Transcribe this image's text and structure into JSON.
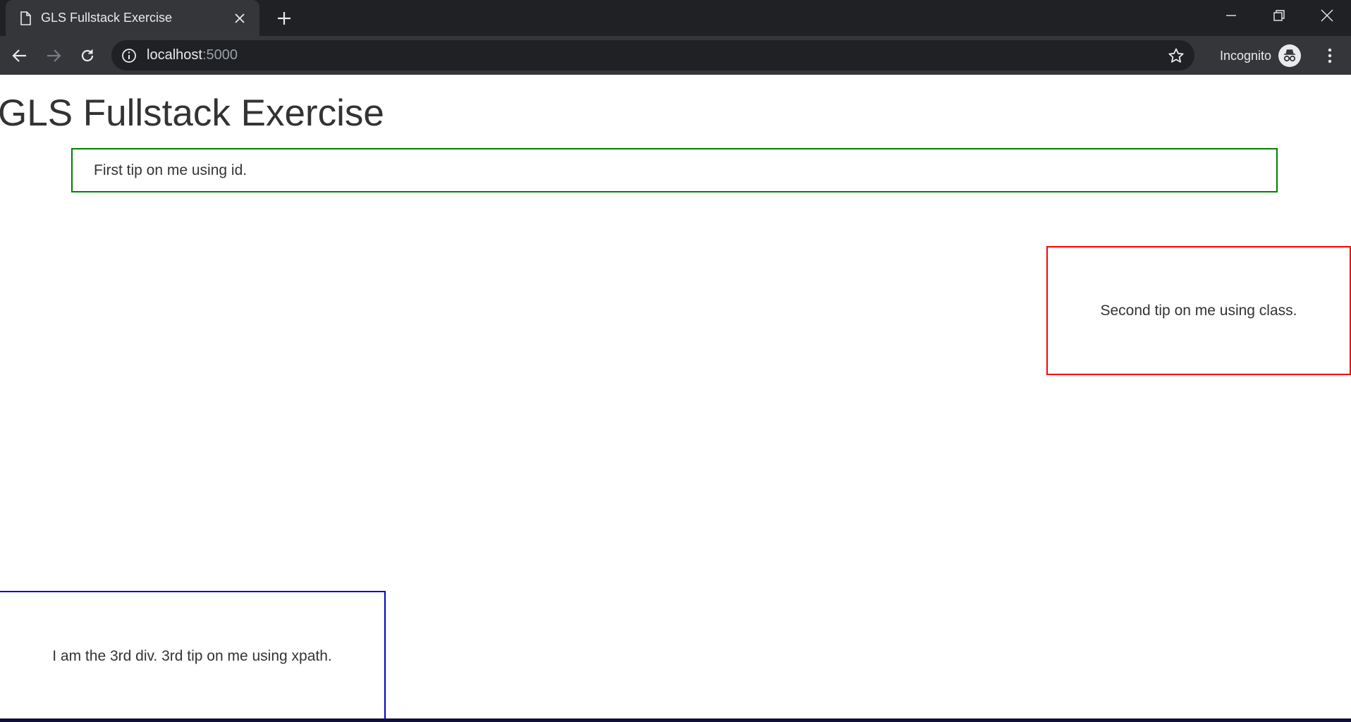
{
  "browser": {
    "tab_title": "GLS Fullstack Exercise",
    "url_host": "localhost",
    "url_port": ":5000",
    "incognito_label": "Incognito",
    "colors": {
      "tabstrip": "#202124",
      "toolbar": "#35363a",
      "omnibox": "#202124",
      "text": "#e8eaed"
    }
  },
  "page": {
    "title": "GLS Fullstack Exercise",
    "tips": [
      {
        "text": "First tip on me using id.",
        "border_color": "#008000"
      },
      {
        "text": "Second tip on me using class.",
        "border_color": "#ff0000"
      },
      {
        "text": "I am the 3rd div. 3rd tip on me using xpath.",
        "border_color": "#0000cc"
      }
    ]
  }
}
